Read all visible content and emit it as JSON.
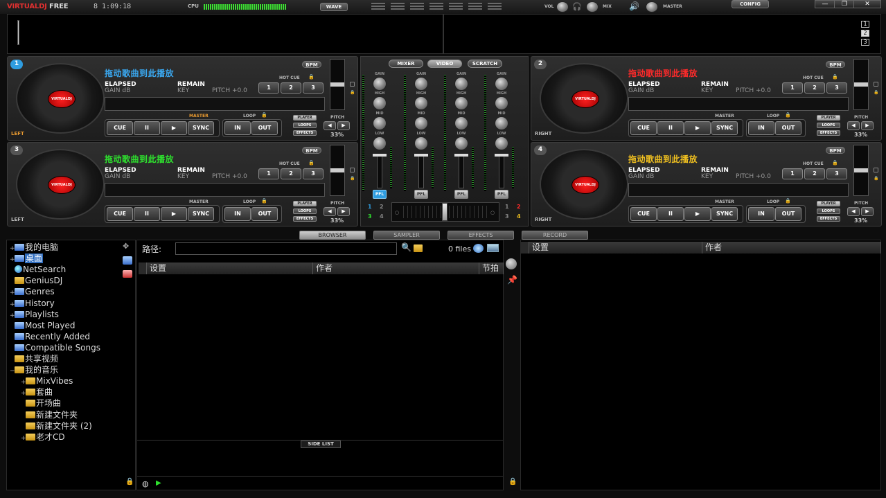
{
  "app": {
    "logo_main": "VIRTUAL",
    "logo_dj": "DJ",
    "logo_free": "FREE",
    "clock": "8 1:09:18",
    "cpu_label": "CPU",
    "wave_btn": "WAVE",
    "vol_label": "VOL",
    "mix_label": "MIX",
    "master_label": "MASTER",
    "config_btn": "CONFIG",
    "win_min": "—",
    "win_max": "❐",
    "win_close": "✕"
  },
  "wave_deck_numbers": [
    "1",
    "2",
    "3"
  ],
  "decks": [
    {
      "num": "1",
      "side": "LEFT",
      "title": "拖动歌曲到此播放",
      "title_color": "#3aa8f0",
      "elapsed": "ELAPSED",
      "remain": "REMAIN",
      "gain": "GAIN dB",
      "key": "KEY",
      "pitch": "PITCH +0.0",
      "bpm": "BPM",
      "hotcue": "HOT CUE",
      "master": "MASTER",
      "loop": "LOOP",
      "player": "PLAYER",
      "loops": "LOOPS",
      "effects": "EFFECTS",
      "pitch_label": "PITCH",
      "pitch_pct": "33%",
      "cue": "CUE",
      "pause": "II",
      "play": "▶",
      "sync": "SYNC",
      "in": "IN",
      "out": "OUT",
      "hc1": "1",
      "hc2": "2",
      "hc3": "3",
      "badge_color": "#2f9de0",
      "label_text": "VIRTUALDJ"
    },
    {
      "num": "2",
      "side": "RIGHT",
      "title": "拖动歌曲到此播放",
      "title_color": "#ff2a2a",
      "elapsed": "ELAPSED",
      "remain": "REMAIN",
      "gain": "GAIN dB",
      "key": "KEY",
      "pitch": "PITCH +0.0",
      "bpm": "BPM",
      "hotcue": "HOT CUE",
      "master": "MASTER",
      "loop": "LOOP",
      "player": "PLAYER",
      "loops": "LOOPS",
      "effects": "EFFECTS",
      "pitch_label": "PITCH",
      "pitch_pct": "33%",
      "cue": "CUE",
      "pause": "II",
      "play": "▶",
      "sync": "SYNC",
      "in": "IN",
      "out": "OUT",
      "hc1": "1",
      "hc2": "2",
      "hc3": "3",
      "badge_color": "#555555",
      "label_text": "VIRTUALDJ"
    },
    {
      "num": "3",
      "side": "LEFT",
      "title": "拖动歌曲到此播放",
      "title_color": "#2ee02e",
      "elapsed": "ELAPSED",
      "remain": "REMAIN",
      "gain": "GAIN dB",
      "key": "KEY",
      "pitch": "PITCH +0.0",
      "bpm": "BPM",
      "hotcue": "HOT CUE",
      "master": "MASTER",
      "loop": "LOOP",
      "player": "PLAYER",
      "loops": "LOOPS",
      "effects": "EFFECTS",
      "pitch_label": "PITCH",
      "pitch_pct": "33%",
      "cue": "CUE",
      "pause": "II",
      "play": "▶",
      "sync": "SYNC",
      "in": "IN",
      "out": "OUT",
      "hc1": "1",
      "hc2": "2",
      "hc3": "3",
      "badge_color": "#555555",
      "label_text": "VIRTUALDJ"
    },
    {
      "num": "4",
      "side": "RIGHT",
      "title": "拖动歌曲到此播放",
      "title_color": "#f0c020",
      "elapsed": "ELAPSED",
      "remain": "REMAIN",
      "gain": "GAIN dB",
      "key": "KEY",
      "pitch": "PITCH +0.0",
      "bpm": "BPM",
      "hotcue": "HOT CUE",
      "master": "MASTER",
      "loop": "LOOP",
      "player": "PLAYER",
      "loops": "LOOPS",
      "effects": "EFFECTS",
      "pitch_label": "PITCH",
      "pitch_pct": "33%",
      "cue": "CUE",
      "pause": "II",
      "play": "▶",
      "sync": "SYNC",
      "in": "IN",
      "out": "OUT",
      "hc1": "1",
      "hc2": "2",
      "hc3": "3",
      "badge_color": "#555555",
      "label_text": "VIRTUALDJ"
    }
  ],
  "mixer": {
    "tabs": [
      "MIXER",
      "VIDEO",
      "SCRATCH"
    ],
    "gain": "GAIN",
    "high": "HIGH",
    "mid": "MID",
    "low": "LOW",
    "pfl": "PFL",
    "ch_left_top": "1",
    "ch_left_top2": "2",
    "ch_left_bot": "3",
    "ch_left_bot2": "4",
    "ch_right_top": "1",
    "ch_right_top2": "2",
    "ch_right_bot": "3",
    "ch_right_bot2": "4"
  },
  "browser_tabs": [
    "BROWSER",
    "SAMPLER",
    "EFFECTS",
    "RECORD"
  ],
  "tree": [
    {
      "label": "我的电脑",
      "plus": "+",
      "icon": "bluefold"
    },
    {
      "label": "桌面",
      "plus": "+",
      "icon": "bluefold",
      "selected": true
    },
    {
      "label": "NetSearch",
      "plus": "",
      "icon": "globe"
    },
    {
      "label": "GeniusDJ",
      "plus": "",
      "icon": "folder"
    },
    {
      "label": "Genres",
      "plus": "+",
      "icon": "bluefold"
    },
    {
      "label": "History",
      "plus": "+",
      "icon": "bluefold"
    },
    {
      "label": "Playlists",
      "plus": "+",
      "icon": "bluefold"
    },
    {
      "label": "Most Played",
      "plus": "",
      "icon": "bluefold"
    },
    {
      "label": "Recently Added",
      "plus": "",
      "icon": "bluefold"
    },
    {
      "label": "Compatible Songs",
      "plus": "",
      "icon": "bluefold"
    },
    {
      "label": "共享视频",
      "plus": "",
      "icon": "folder"
    },
    {
      "label": "我的音乐",
      "plus": "−",
      "icon": "folder"
    },
    {
      "label": "MixVibes",
      "plus": "+",
      "icon": "folder",
      "indent": 1
    },
    {
      "label": "套曲",
      "plus": "+",
      "icon": "folder",
      "indent": 1
    },
    {
      "label": "开场曲",
      "plus": "",
      "icon": "folder",
      "indent": 1
    },
    {
      "label": "新建文件夹",
      "plus": "",
      "icon": "folder",
      "indent": 1
    },
    {
      "label": "新建文件夹 (2)",
      "plus": "",
      "icon": "folder",
      "indent": 1
    },
    {
      "label": "老才CD",
      "plus": "+",
      "icon": "folder",
      "indent": 1
    }
  ],
  "filepane": {
    "path_label": "路径:",
    "path_value": "",
    "files": "0 files",
    "col1": "设置",
    "col2": "作者",
    "col3": "节拍",
    "side_list": "SIDE LIST"
  },
  "rightpane": {
    "col1": "设置",
    "col2": "作者"
  }
}
